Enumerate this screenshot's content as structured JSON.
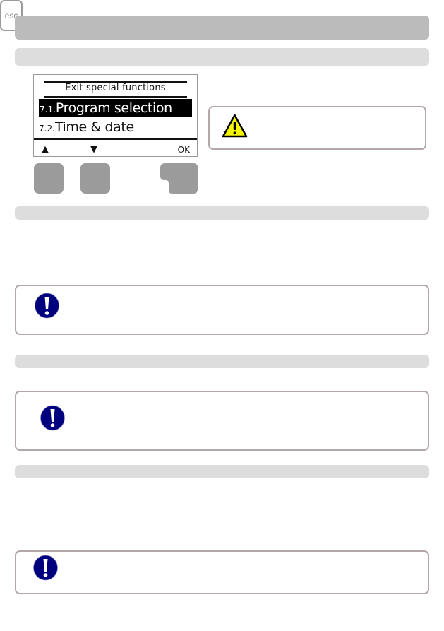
{
  "page": {
    "header_bar": {
      "label": ""
    },
    "section_bars": [
      {
        "label": ""
      },
      {
        "label": ""
      },
      {
        "label": ""
      },
      {
        "label": ""
      }
    ]
  },
  "lcd": {
    "title": "Exit special functions",
    "menu_items": [
      {
        "number": "7.1.",
        "label": "Program selection",
        "selected": true
      },
      {
        "number": "7.2.",
        "label": "Time & date",
        "selected": false
      }
    ],
    "softkeys": {
      "up": "▲",
      "down": "▼",
      "ok": "OK"
    }
  },
  "keys": {
    "esc_label": "esc"
  },
  "warning_box": {
    "icon": "warning-triangle-icon",
    "text": ""
  },
  "info_boxes": [
    {
      "icon": "exclamation-icon",
      "text": ""
    },
    {
      "icon": "exclamation-icon",
      "text": ""
    },
    {
      "icon": "exclamation-icon",
      "text": ""
    }
  ],
  "colors": {
    "header_bar": "#bbbbbb",
    "section_bar": "#dddddd",
    "box_border": "#b3a7a8",
    "key_grey": "#9b9b9b",
    "info_icon_blue": "#00007f",
    "warning_yellow": "#f5f500"
  }
}
